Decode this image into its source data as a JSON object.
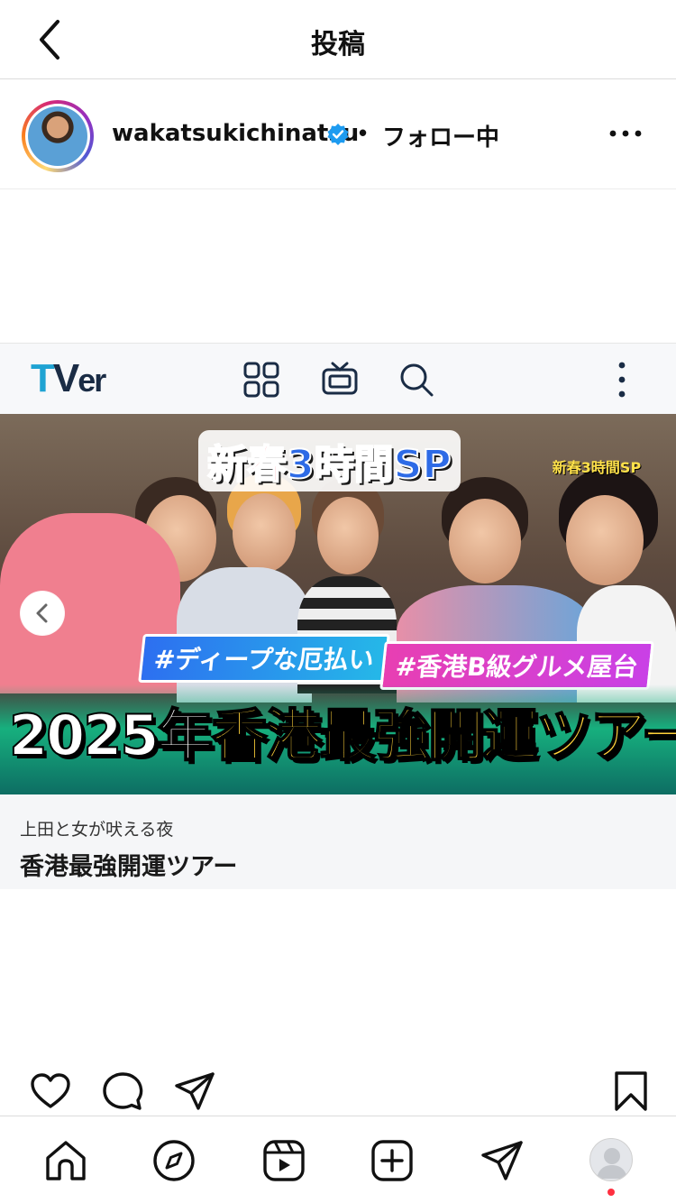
{
  "header": {
    "title": "投稿",
    "back_icon": "chevron-left-icon"
  },
  "post": {
    "username": "wakatsukichinatsu",
    "verified": true,
    "separator": "•",
    "follow_status": "フォロー中",
    "more_icon": "more-horizontal-icon"
  },
  "card": {
    "site_logo": {
      "t": "T",
      "v": "V",
      "er": "er"
    },
    "toolbar_icons": [
      "grid-icon",
      "tv-icon",
      "search-icon",
      "more-vertical-icon"
    ],
    "thumbnail": {
      "banner_text_a": "新春",
      "banner_text_b": "3時間",
      "banner_text_c": "SP",
      "corner_text": "新春3時間SP",
      "tag_1": "#ディープな厄払い",
      "tag_2": "#香港B級グルメ屋台",
      "title_year": "2025年",
      "title_main": "香港最強開運ツアー"
    },
    "program_name": "上田と女が吠える夜",
    "episode_title": "香港最強開運ツアー"
  },
  "actions": [
    "heart-icon",
    "comment-icon",
    "share-icon",
    "bookmark-icon"
  ],
  "bottom_nav": [
    "home-icon",
    "explore-icon",
    "reels-icon",
    "create-icon",
    "direct-icon",
    "profile-avatar"
  ],
  "colors": {
    "verified": "#1d9bf0",
    "notification_dot": "#ff3040",
    "tver_blue": "#1fa3d3"
  }
}
